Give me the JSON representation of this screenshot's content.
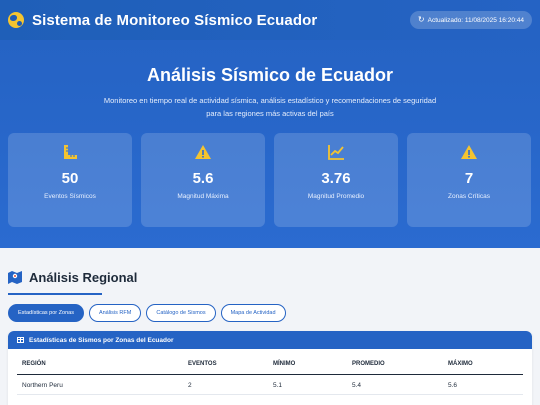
{
  "header": {
    "title": "Sistema de Monitoreo Sísmico Ecuador",
    "updated": "Actualizado: 11/08/2025 16:20:44"
  },
  "hero": {
    "title": "Análisis Sísmico de Ecuador",
    "subtitle": "Monitoreo en tiempo real de actividad sísmica, análisis estadístico y recomendaciones de seguridad para las regiones más activas del país"
  },
  "stats": [
    {
      "icon": "ruler-icon",
      "value": "50",
      "label": "Eventos Sísmicos"
    },
    {
      "icon": "warning-icon",
      "value": "5.6",
      "label": "Magnitud Máxima"
    },
    {
      "icon": "line-chart-icon",
      "value": "3.76",
      "label": "Magnitud Promedio"
    },
    {
      "icon": "alert-icon",
      "value": "7",
      "label": "Zonas Críticas"
    }
  ],
  "regional": {
    "title": "Análisis Regional",
    "tabs": [
      "Estadísticas por Zonas",
      "Análisis RFM",
      "Catálogo de Sismos",
      "Mapa de Actividad"
    ],
    "table_title": "Estadísticas de Sismos por Zonas del Ecuador",
    "columns": [
      "REGIÓN",
      "EVENTOS",
      "MÍNIMO",
      "PROMEDIO",
      "MÁXIMO"
    ],
    "rows": [
      {
        "region": "Northern Peru",
        "events": "2",
        "min": "5.1",
        "avg": "5.4",
        "max": "5.6"
      }
    ]
  },
  "colors": {
    "primary": "#2563c4",
    "accent": "#f4c430"
  }
}
